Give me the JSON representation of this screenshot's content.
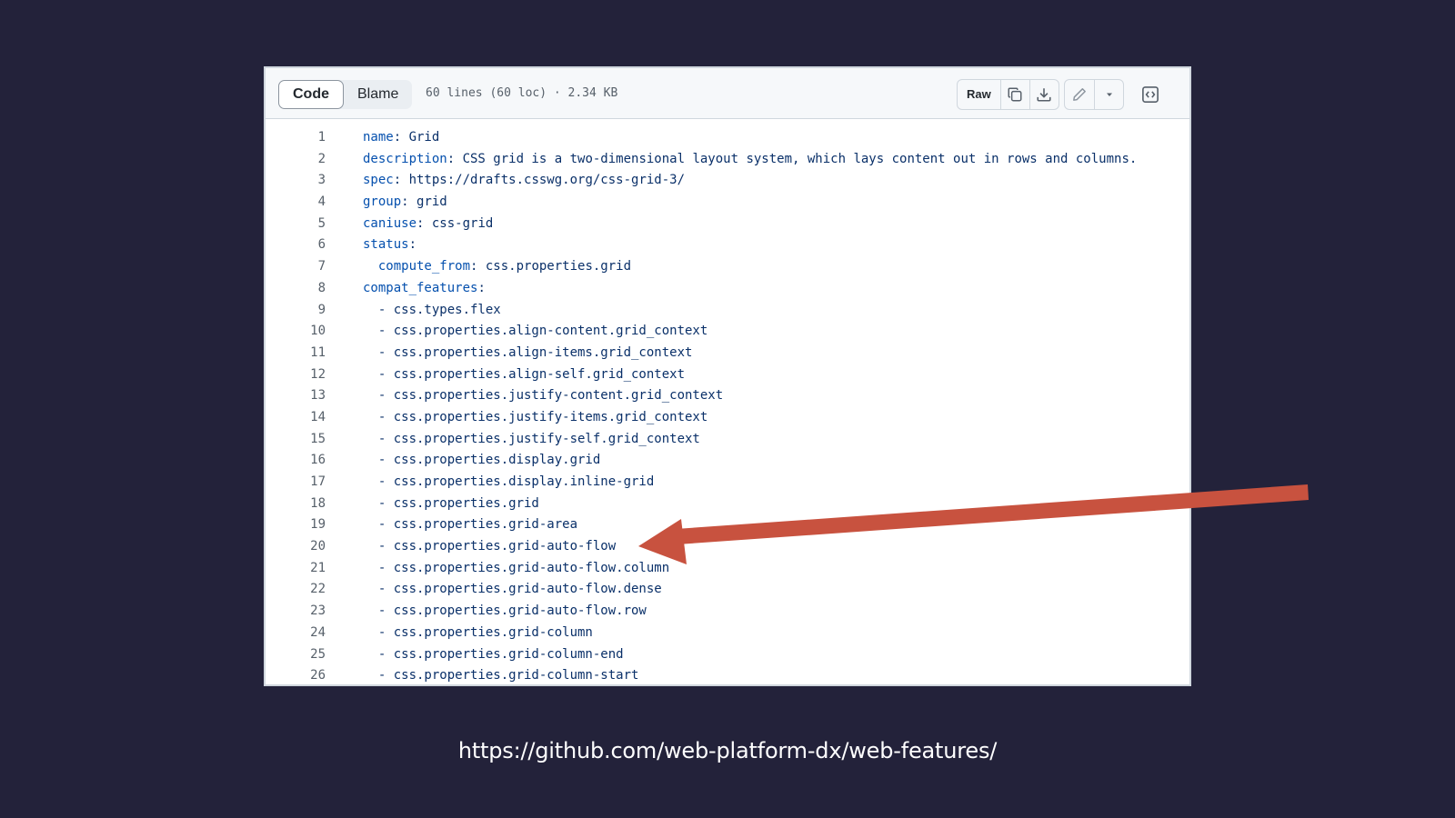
{
  "toolbar": {
    "tabs": [
      {
        "label": "Code",
        "active": true
      },
      {
        "label": "Blame",
        "active": false
      }
    ],
    "file_info": "60 lines (60 loc) · 2.34 KB",
    "raw_label": "Raw",
    "icons": [
      "copy-icon",
      "download-icon",
      "pencil-icon",
      "triangle-down-icon",
      "code-square-icon"
    ]
  },
  "code": {
    "lines": [
      {
        "num": "1",
        "indent": "",
        "key": "name",
        "sep": ": ",
        "value": "Grid"
      },
      {
        "num": "2",
        "indent": "",
        "key": "description",
        "sep": ": ",
        "value": "CSS grid is a two-dimensional layout system, which lays content out in rows and columns."
      },
      {
        "num": "3",
        "indent": "",
        "key": "spec",
        "sep": ": ",
        "value": "https://drafts.csswg.org/css-grid-3/"
      },
      {
        "num": "4",
        "indent": "",
        "key": "group",
        "sep": ": ",
        "value": "grid"
      },
      {
        "num": "5",
        "indent": "",
        "key": "caniuse",
        "sep": ": ",
        "value": "css-grid"
      },
      {
        "num": "6",
        "indent": "",
        "key": "status",
        "sep": ":",
        "value": ""
      },
      {
        "num": "7",
        "indent": "  ",
        "key": "compute_from",
        "sep": ": ",
        "value": "css.properties.grid"
      },
      {
        "num": "8",
        "indent": "",
        "key": "compat_features",
        "sep": ":",
        "value": ""
      },
      {
        "num": "9",
        "indent": "  ",
        "key": "",
        "sep": "",
        "value": "- css.types.flex"
      },
      {
        "num": "10",
        "indent": "  ",
        "key": "",
        "sep": "",
        "value": "- css.properties.align-content.grid_context"
      },
      {
        "num": "11",
        "indent": "  ",
        "key": "",
        "sep": "",
        "value": "- css.properties.align-items.grid_context"
      },
      {
        "num": "12",
        "indent": "  ",
        "key": "",
        "sep": "",
        "value": "- css.properties.align-self.grid_context"
      },
      {
        "num": "13",
        "indent": "  ",
        "key": "",
        "sep": "",
        "value": "- css.properties.justify-content.grid_context"
      },
      {
        "num": "14",
        "indent": "  ",
        "key": "",
        "sep": "",
        "value": "- css.properties.justify-items.grid_context"
      },
      {
        "num": "15",
        "indent": "  ",
        "key": "",
        "sep": "",
        "value": "- css.properties.justify-self.grid_context"
      },
      {
        "num": "16",
        "indent": "  ",
        "key": "",
        "sep": "",
        "value": "- css.properties.display.grid"
      },
      {
        "num": "17",
        "indent": "  ",
        "key": "",
        "sep": "",
        "value": "- css.properties.display.inline-grid"
      },
      {
        "num": "18",
        "indent": "  ",
        "key": "",
        "sep": "",
        "value": "- css.properties.grid"
      },
      {
        "num": "19",
        "indent": "  ",
        "key": "",
        "sep": "",
        "value": "- css.properties.grid-area"
      },
      {
        "num": "20",
        "indent": "  ",
        "key": "",
        "sep": "",
        "value": "- css.properties.grid-auto-flow"
      },
      {
        "num": "21",
        "indent": "  ",
        "key": "",
        "sep": "",
        "value": "- css.properties.grid-auto-flow.column"
      },
      {
        "num": "22",
        "indent": "  ",
        "key": "",
        "sep": "",
        "value": "- css.properties.grid-auto-flow.dense"
      },
      {
        "num": "23",
        "indent": "  ",
        "key": "",
        "sep": "",
        "value": "- css.properties.grid-auto-flow.row"
      },
      {
        "num": "24",
        "indent": "  ",
        "key": "",
        "sep": "",
        "value": "- css.properties.grid-column"
      },
      {
        "num": "25",
        "indent": "  ",
        "key": "",
        "sep": "",
        "value": "- css.properties.grid-column-end"
      },
      {
        "num": "26",
        "indent": "  ",
        "key": "",
        "sep": "",
        "value": "- css.properties.grid-column-start"
      }
    ]
  },
  "caption": "https://github.com/web-platform-dx/web-features/",
  "colors": {
    "background": "#23223a",
    "arrow": "#c8523f",
    "key": "#0550ae",
    "value": "#0a3069",
    "line_number": "#57606a"
  }
}
